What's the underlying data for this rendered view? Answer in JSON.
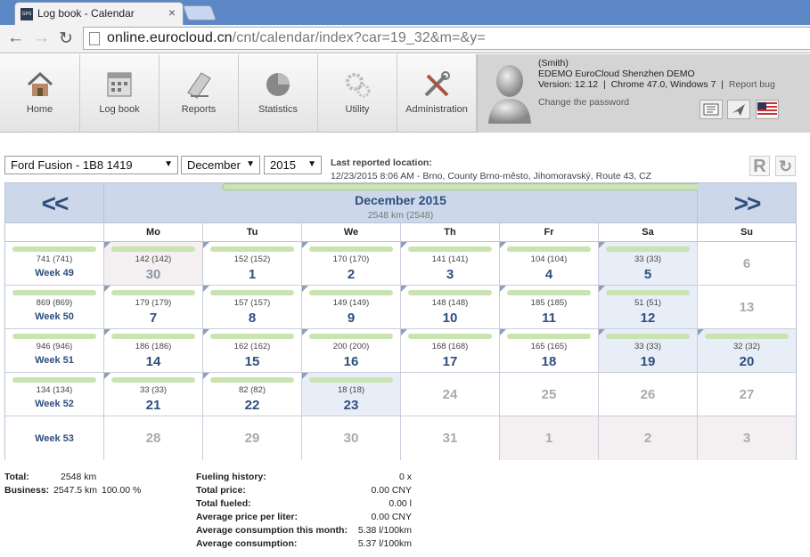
{
  "browser": {
    "tab_title": "Log book - Calendar",
    "tab_close": "×",
    "favicon_text": "GPS",
    "url_host": "online.eurocloud.cn",
    "url_path": "/cnt/calendar/index?car=19_32&m=&y="
  },
  "nav": {
    "items": [
      {
        "label": "Home",
        "icon": "home-icon"
      },
      {
        "label": "Log book",
        "icon": "logbook-icon"
      },
      {
        "label": "Reports",
        "icon": "reports-icon"
      },
      {
        "label": "Statistics",
        "icon": "statistics-icon"
      },
      {
        "label": "Utility",
        "icon": "utility-icon"
      },
      {
        "label": "Administration",
        "icon": "administration-icon"
      }
    ]
  },
  "user": {
    "name": "(Smith)",
    "company": "EDEMO EuroCloud Shenzhen DEMO",
    "version": "Version: 12.12",
    "sep1": "|",
    "browser": "Chrome 47.0, Windows 7",
    "sep2": "|",
    "report_bug": "Report bug",
    "change_password": "Change the password"
  },
  "controls": {
    "car": "Ford Fusion - 1B8 1419",
    "month": "December",
    "year": "2015",
    "last_location_label": "Last reported location:",
    "last_location_value": "12/23/2015 8:06 AM - Brno, County Brno-město, Jihomoravský, Route 43, CZ",
    "r_button": "R"
  },
  "calendar": {
    "prev": "<<",
    "next": ">>",
    "title": "December 2015",
    "subtitle": "2548 km (2548)",
    "day_headers": [
      "Mo",
      "Tu",
      "We",
      "Th",
      "Fr",
      "Sa",
      "Su"
    ],
    "weeks": [
      {
        "label": "Week 49",
        "km": "741 (741)",
        "has_bar": true,
        "days": [
          {
            "day": "30",
            "km": "142 (142)",
            "bar": true,
            "state": "other"
          },
          {
            "day": "1",
            "km": "152 (152)",
            "bar": true,
            "state": "cur"
          },
          {
            "day": "2",
            "km": "170 (170)",
            "bar": true,
            "state": "cur"
          },
          {
            "day": "3",
            "km": "141 (141)",
            "bar": true,
            "state": "cur"
          },
          {
            "day": "4",
            "km": "104 (104)",
            "bar": true,
            "state": "cur"
          },
          {
            "day": "5",
            "km": "33 (33)",
            "bar": true,
            "state": "past"
          },
          {
            "day": "6",
            "km": "",
            "bar": false,
            "state": "grey"
          }
        ]
      },
      {
        "label": "Week 50",
        "km": "869 (869)",
        "has_bar": true,
        "days": [
          {
            "day": "7",
            "km": "179 (179)",
            "bar": true,
            "state": "cur"
          },
          {
            "day": "8",
            "km": "157 (157)",
            "bar": true,
            "state": "cur"
          },
          {
            "day": "9",
            "km": "149 (149)",
            "bar": true,
            "state": "cur"
          },
          {
            "day": "10",
            "km": "148 (148)",
            "bar": true,
            "state": "cur"
          },
          {
            "day": "11",
            "km": "185 (185)",
            "bar": true,
            "state": "cur"
          },
          {
            "day": "12",
            "km": "51 (51)",
            "bar": true,
            "state": "past"
          },
          {
            "day": "13",
            "km": "",
            "bar": false,
            "state": "grey"
          }
        ]
      },
      {
        "label": "Week 51",
        "km": "946 (946)",
        "has_bar": true,
        "days": [
          {
            "day": "14",
            "km": "186 (186)",
            "bar": true,
            "state": "cur"
          },
          {
            "day": "15",
            "km": "162 (162)",
            "bar": true,
            "state": "cur"
          },
          {
            "day": "16",
            "km": "200 (200)",
            "bar": true,
            "state": "cur"
          },
          {
            "day": "17",
            "km": "168 (168)",
            "bar": true,
            "state": "cur"
          },
          {
            "day": "18",
            "km": "165 (165)",
            "bar": true,
            "state": "cur"
          },
          {
            "day": "19",
            "km": "33 (33)",
            "bar": true,
            "state": "past"
          },
          {
            "day": "20",
            "km": "32 (32)",
            "bar": true,
            "state": "past"
          }
        ]
      },
      {
        "label": "Week 52",
        "km": "134 (134)",
        "has_bar": true,
        "days": [
          {
            "day": "21",
            "km": "33 (33)",
            "bar": true,
            "state": "cur"
          },
          {
            "day": "22",
            "km": "82 (82)",
            "bar": true,
            "state": "cur"
          },
          {
            "day": "23",
            "km": "18 (18)",
            "bar": true,
            "state": "past"
          },
          {
            "day": "24",
            "km": "",
            "bar": false,
            "state": "grey"
          },
          {
            "day": "25",
            "km": "",
            "bar": false,
            "state": "grey"
          },
          {
            "day": "26",
            "km": "",
            "bar": false,
            "state": "grey"
          },
          {
            "day": "27",
            "km": "",
            "bar": false,
            "state": "grey"
          }
        ]
      },
      {
        "label": "Week 53",
        "km": "",
        "has_bar": false,
        "days": [
          {
            "day": "28",
            "km": "",
            "bar": false,
            "state": "grey"
          },
          {
            "day": "29",
            "km": "",
            "bar": false,
            "state": "grey"
          },
          {
            "day": "30",
            "km": "",
            "bar": false,
            "state": "grey"
          },
          {
            "day": "31",
            "km": "",
            "bar": false,
            "state": "grey"
          },
          {
            "day": "1",
            "km": "",
            "bar": false,
            "state": "greyother"
          },
          {
            "day": "2",
            "km": "",
            "bar": false,
            "state": "greyother"
          },
          {
            "day": "3",
            "km": "",
            "bar": false,
            "state": "greyother"
          }
        ]
      }
    ]
  },
  "summary": {
    "total_label": "Total:",
    "total_value": "2548 km",
    "business_label": "Business:",
    "business_km": "2547.5 km",
    "business_pct": "100.00 %",
    "stats": [
      {
        "label": "Fueling history:",
        "value": "0 x"
      },
      {
        "label": "Total price:",
        "value": "0.00 CNY"
      },
      {
        "label": "Total fueled:",
        "value": "0.00 l"
      },
      {
        "label": "Average price per liter:",
        "value": "0.00 CNY"
      },
      {
        "label": "Average consumption this month:",
        "value": "5.38 l/100km"
      },
      {
        "label": "Average consumption:",
        "value": "5.37 l/100km"
      }
    ]
  },
  "colors": {
    "accent": "#2f4e7e",
    "bar": "#c9e3b1",
    "header_bg": "#ccd8ea"
  }
}
